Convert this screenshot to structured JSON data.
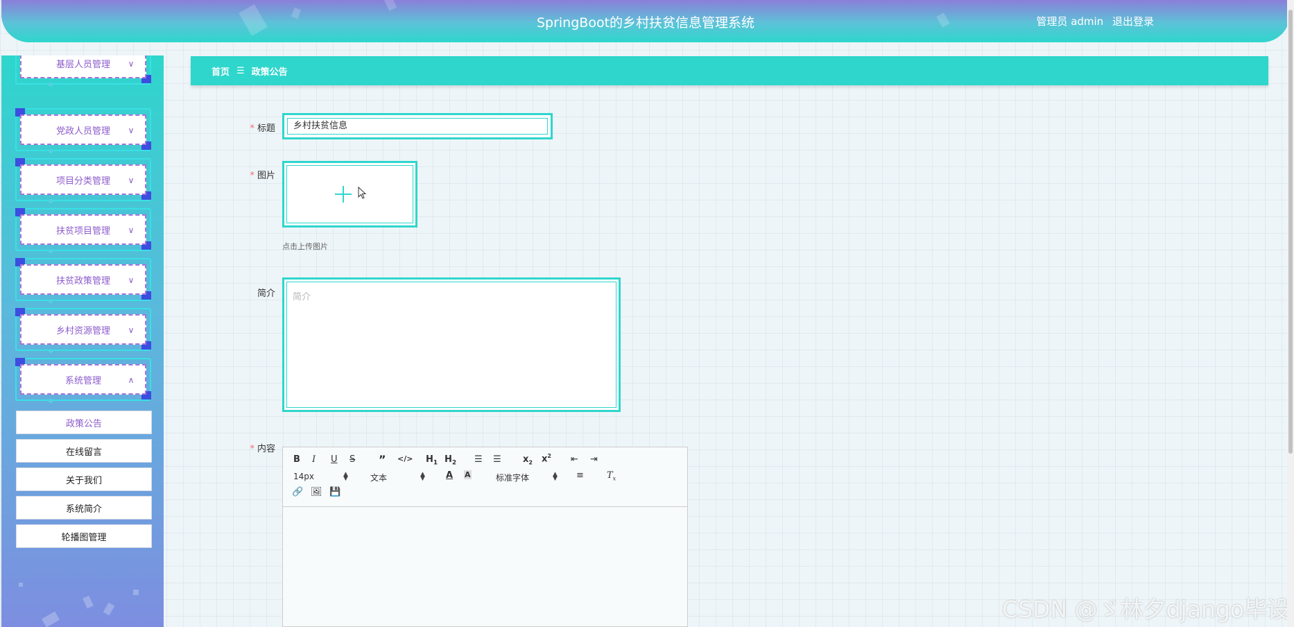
{
  "header": {
    "title": "SpringBoot的乡村扶贫信息管理系统",
    "user_label": "管理员 admin",
    "logout_label": "退出登录"
  },
  "sidebar": {
    "groups": [
      {
        "label": "基层人员管理",
        "expanded": false
      },
      {
        "label": "党政人员管理",
        "expanded": false
      },
      {
        "label": "项目分类管理",
        "expanded": false
      },
      {
        "label": "扶贫项目管理",
        "expanded": false
      },
      {
        "label": "扶贫政策管理",
        "expanded": false
      },
      {
        "label": "乡村资源管理",
        "expanded": false
      },
      {
        "label": "系统管理",
        "expanded": true
      }
    ],
    "submenu": [
      {
        "label": "政策公告",
        "active": true
      },
      {
        "label": "在线留言",
        "active": false
      },
      {
        "label": "关于我们",
        "active": false
      },
      {
        "label": "系统简介",
        "active": false
      },
      {
        "label": "轮播图管理",
        "active": false
      }
    ]
  },
  "breadcrumb": {
    "home": "首页",
    "separator": "☰",
    "current": "政策公告"
  },
  "form": {
    "title_label": "标题",
    "title_value": "乡村扶贫信息",
    "image_label": "图片",
    "upload_hint": "点击上传图片",
    "intro_label": "简介",
    "intro_placeholder": "简介",
    "content_label": "内容",
    "required_mark": "*"
  },
  "editor": {
    "font_size": "14px",
    "text_style": "文本",
    "font_family": "标准字体"
  },
  "watermark": "CSDN @ゞ林夕django毕设",
  "colors": {
    "accent": "#2ed6cc",
    "menu_text": "#8d5ccc",
    "required": "#f56c6c"
  }
}
